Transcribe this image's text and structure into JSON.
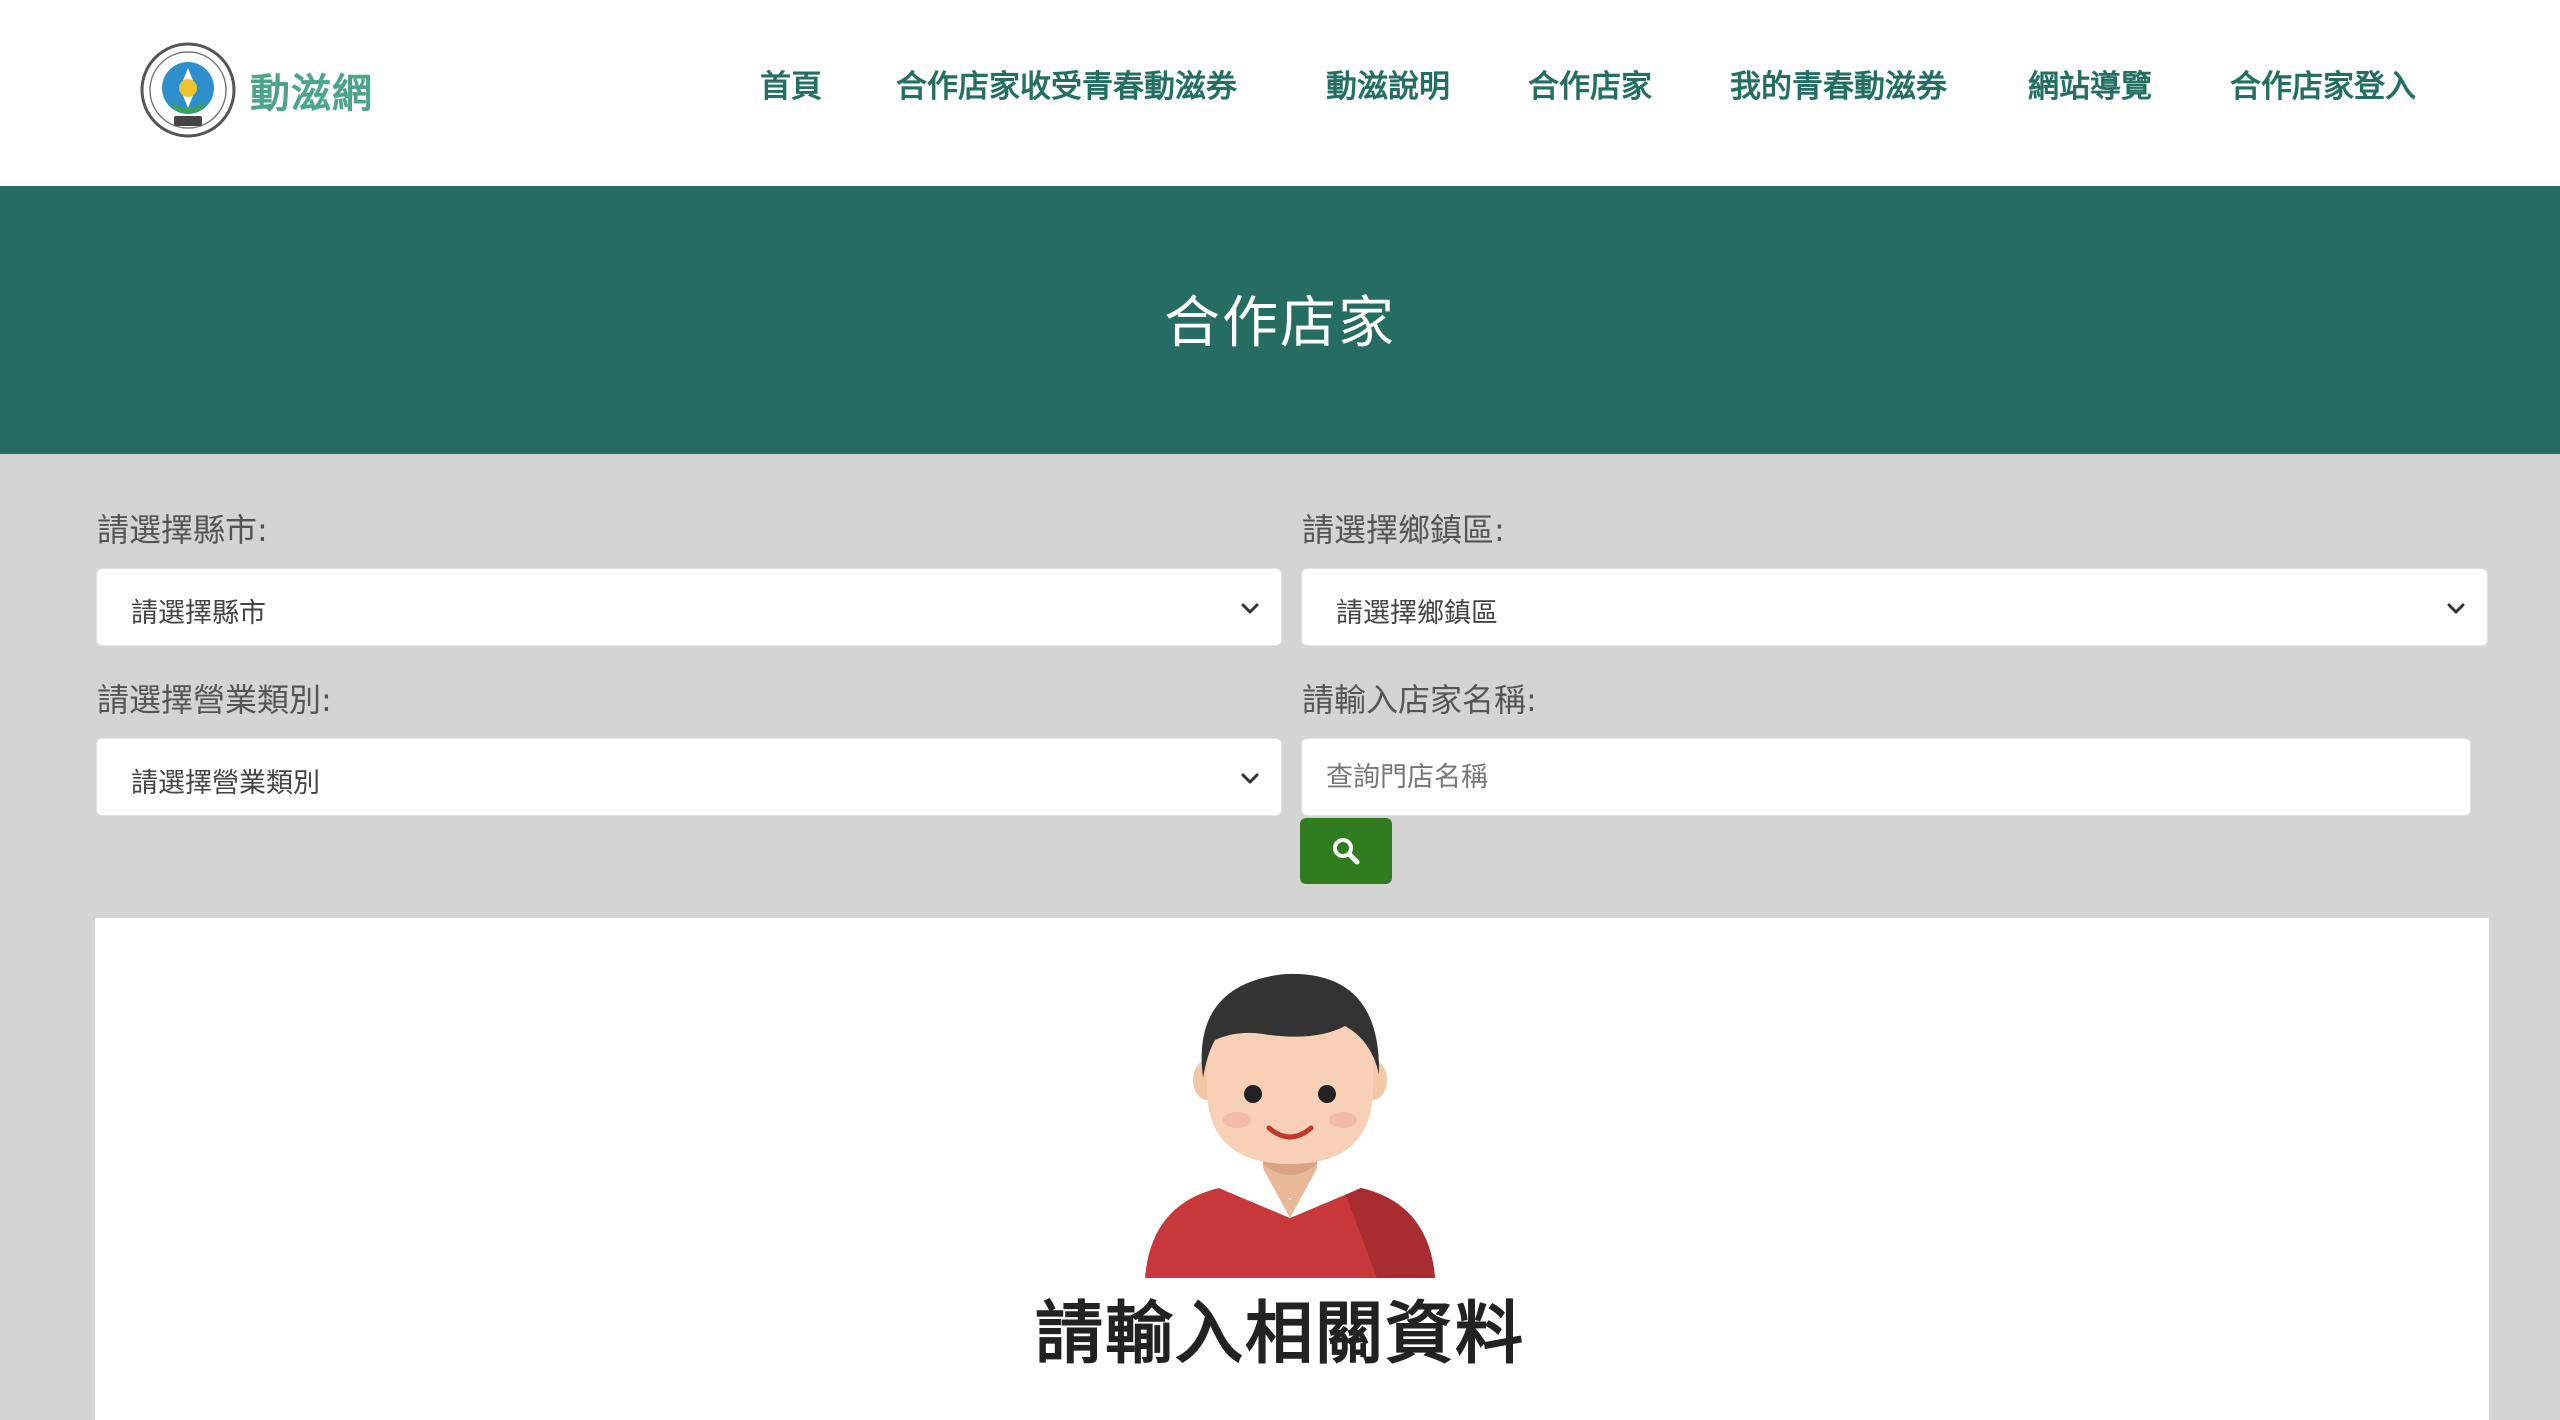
{
  "header": {
    "logo_text": "動滋網",
    "seal_icon": "ministry-of-education-seal",
    "nav": [
      {
        "label": "首頁"
      },
      {
        "label": "合作店家收受青春動滋券"
      },
      {
        "label": "動滋說明"
      },
      {
        "label": "合作店家"
      },
      {
        "label": "我的青春動滋券"
      },
      {
        "label": "網站導覽"
      },
      {
        "label": "合作店家登入"
      }
    ]
  },
  "banner": {
    "title": "合作店家"
  },
  "filters": {
    "county": {
      "label": "請選擇縣市:",
      "selected": "請選擇縣市"
    },
    "district": {
      "label": "請選擇鄉鎮區:",
      "selected": "請選擇鄉鎮區"
    },
    "category": {
      "label": "請選擇營業類別:",
      "selected": "請選擇營業類別"
    },
    "store_name": {
      "label": "請輸入店家名稱:",
      "placeholder": "查詢門店名稱",
      "value": ""
    },
    "search_icon": "search-icon"
  },
  "result": {
    "avatar_icon": "person-avatar-illustration",
    "message": "請輸入相關資料"
  },
  "colors": {
    "brand_green": "#256d63",
    "nav_text": "#237063",
    "logo_text": "#4aa58a",
    "search_button": "#2f7d1f",
    "page_background": "#d4d4d4"
  }
}
